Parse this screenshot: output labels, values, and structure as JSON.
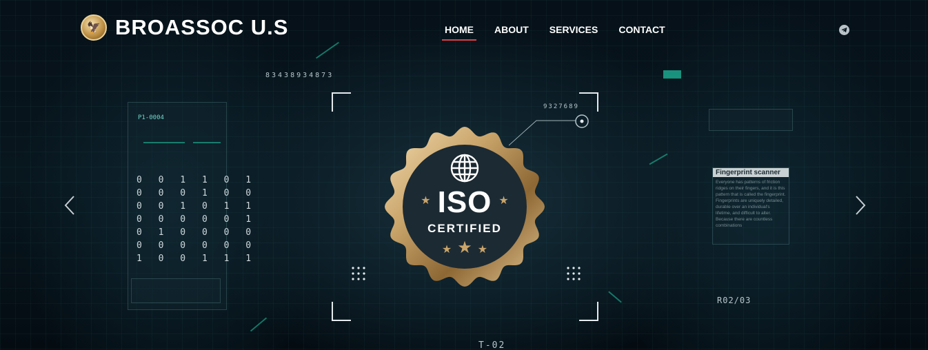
{
  "header": {
    "brand": "BROASSOC U.S",
    "nav": [
      {
        "label": "HOME",
        "active": true
      },
      {
        "label": "ABOUT",
        "active": false
      },
      {
        "label": "SERVICES",
        "active": false
      },
      {
        "label": "CONTACT",
        "active": false
      }
    ],
    "social_icon": "telegram-icon"
  },
  "slider": {
    "badge": {
      "title": "ISO",
      "subtitle": "CERTIFIED"
    },
    "prev_icon": "chevron-left-icon",
    "next_icon": "chevron-right-icon"
  },
  "background_text": {
    "top_code": "83438934873",
    "panel_id": "P1-0004",
    "right_code": "9327689",
    "scanner_title": "Fingerprint scanner",
    "scanner_body": "Everyone has patterns of friction ridges on their fingers, and it is this pattern that is called the fingerprint. Fingerprints are uniquely detailed, durable over an individual's lifetime, and difficult to alter. Because there are countless combinations",
    "counter": "R02/03",
    "bottom_code": "T-02",
    "binary_rows": [
      "0 0 1 1 0 1",
      "0 0 0 1 0 0",
      "0 0 1 0 1 1",
      "0 0 0 0 0 1",
      "0 1 0 0 0 0",
      "0 0 0 0 0 0",
      "1 0 0 1 1 1"
    ]
  },
  "colors": {
    "accent": "#e0404a",
    "badge_gold": "#c9a46a",
    "badge_navy": "#1c2a33",
    "hud_teal": "#1fc8a4"
  }
}
